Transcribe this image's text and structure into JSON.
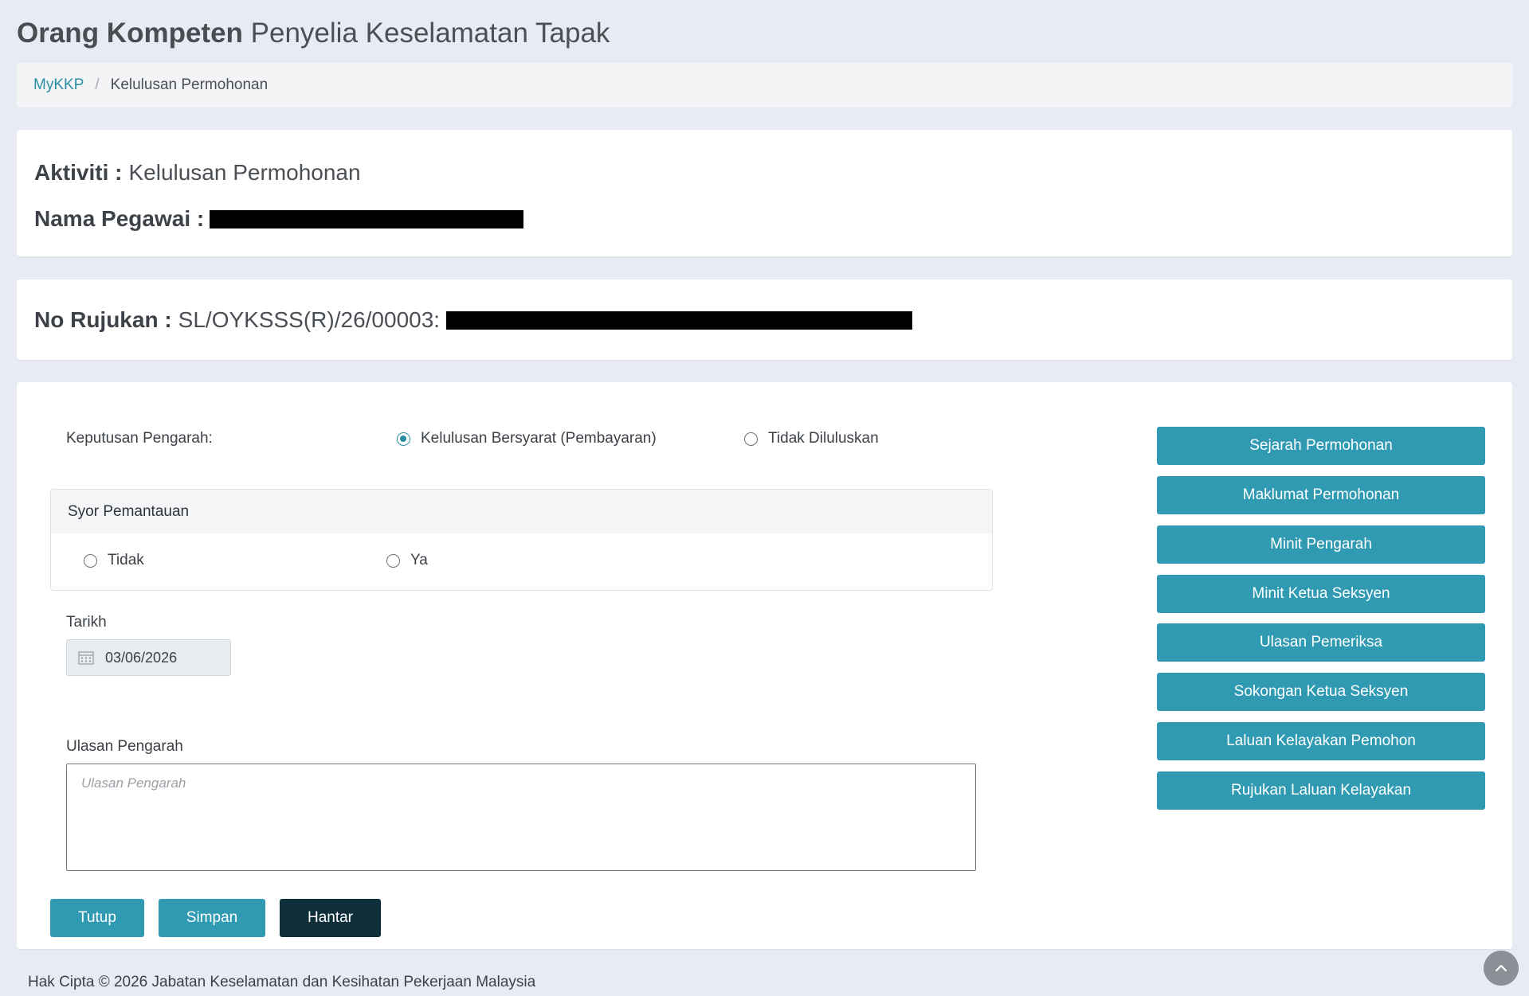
{
  "header": {
    "title_strong": "Orang Kompeten",
    "title_light": "Penyelia Keselamatan Tapak"
  },
  "breadcrumb": {
    "home": "MyKKP",
    "separator": "/",
    "current": "Kelulusan Permohonan"
  },
  "info": {
    "activity_label": "Aktiviti :",
    "activity_value": "Kelulusan Permohonan",
    "officer_label": "Nama Pegawai :"
  },
  "reference": {
    "label": "No Rujukan :",
    "value": "SL/OYKSSS(R)/26/00003:"
  },
  "form": {
    "decision_label": "Keputusan Pengarah:",
    "decision_options": [
      "Kelulusan Bersyarat (Pembayaran)",
      "Tidak Diluluskan"
    ],
    "decision_selected": "Kelulusan Bersyarat (Pembayaran)",
    "syor_title": "Syor Pemantauan",
    "syor_options": [
      "Tidak",
      "Ya"
    ],
    "date_label": "Tarikh",
    "date_value": "03/06/2026",
    "comment_label": "Ulasan Pengarah",
    "comment_placeholder": "Ulasan Pengarah",
    "buttons": {
      "close": "Tutup",
      "save": "Simpan",
      "submit": "Hantar"
    }
  },
  "sidebar": {
    "buttons": [
      "Sejarah Permohonan",
      "Maklumat Permohonan",
      "Minit Pengarah",
      "Minit Ketua Seksyen",
      "Ulasan Pemeriksa",
      "Sokongan Ketua Seksyen",
      "Laluan Kelayakan Pemohon",
      "Rujukan Laluan Kelayakan"
    ]
  },
  "footer": {
    "copyright": "Hak Cipta © 2026 Jabatan Keselamatan dan Kesihatan Pekerjaan Malaysia"
  },
  "colors": {
    "accent": "#2f9ab2",
    "dark_button": "#0f2f3a",
    "background": "#e9ebf4",
    "link": "#2a8da3"
  }
}
